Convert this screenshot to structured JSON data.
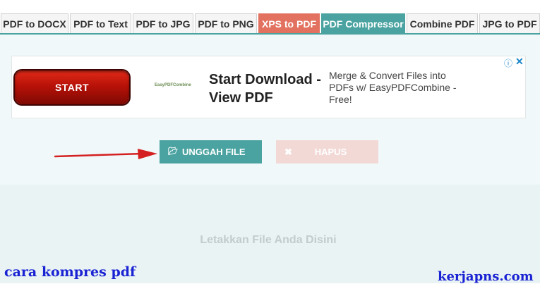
{
  "tabs": [
    {
      "label": "PDF to DOCX"
    },
    {
      "label": "PDF to Text"
    },
    {
      "label": "PDF to JPG"
    },
    {
      "label": "PDF to PNG"
    },
    {
      "label": "XPS to PDF"
    },
    {
      "label": "PDF Compressor"
    },
    {
      "label": "Combine PDF"
    },
    {
      "label": "JPG to PDF"
    }
  ],
  "active_tab": "PDF Compressor",
  "ad": {
    "start_label": "START",
    "logo": "EasyPDFCombine",
    "title": "Start Download - View PDF",
    "description": "Merge & Convert Files into PDFs w/ EasyPDFCombine - Free!",
    "info_icon": "info-circle-icon",
    "close_icon": "close-icon"
  },
  "buttons": {
    "upload_label": "UNGGAH FILE",
    "upload_icon": "folder-open-icon",
    "delete_label": "HAPUS",
    "delete_icon": "close-icon"
  },
  "drop_zone": {
    "label": "Letakkan File Anda Disini"
  },
  "watermark": {
    "left": "cara kompres pdf",
    "right": "kerjapns.com"
  },
  "colors": {
    "teal": "#4aa3a1",
    "xps": "#e27160",
    "delete_disabled": "#f2d9d6",
    "arrow": "#d42020",
    "watermark": "#1a23d3"
  }
}
